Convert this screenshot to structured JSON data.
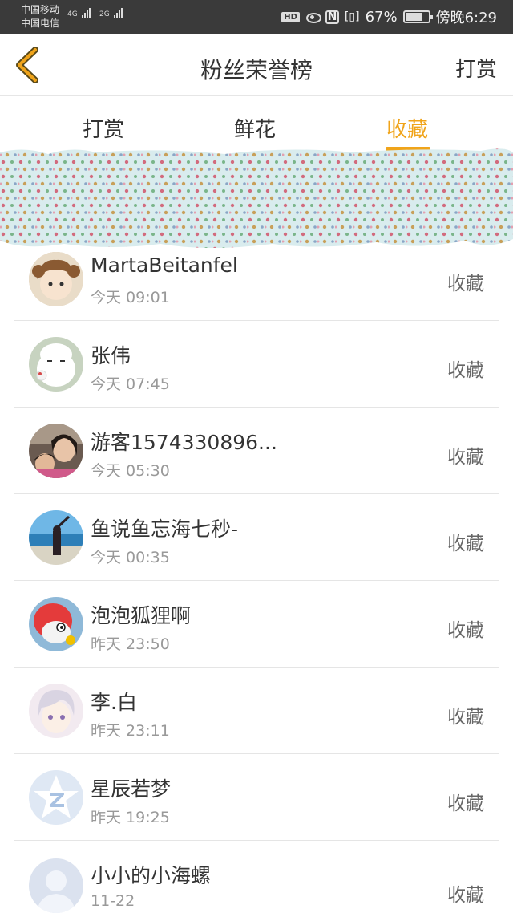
{
  "status_bar": {
    "carrier1": "中国移动",
    "carrier2": "中国电信",
    "net1": "4G",
    "net2": "2G",
    "hd": "HD",
    "nfc": "N",
    "battery": "67%",
    "time": "傍晚6:29"
  },
  "header": {
    "title": "粉丝荣誉榜",
    "right_action": "打赏"
  },
  "tabs": [
    {
      "label": "打赏",
      "active": false
    },
    {
      "label": "鲜花",
      "active": false
    },
    {
      "label": "收藏",
      "active": true
    }
  ],
  "colors": {
    "accent": "#f0a41a"
  },
  "fans": [
    {
      "name": "MartaBeitanfel",
      "time": "今天 09:01",
      "action": "收藏",
      "avatar": "anime-girl-avatar"
    },
    {
      "name": "张伟",
      "time": "今天 07:45",
      "action": "收藏",
      "avatar": "white-rabbit-avatar"
    },
    {
      "name": "游客1574330896...",
      "time": "今天 05:30",
      "action": "收藏",
      "avatar": "photo-people-avatar"
    },
    {
      "name": "鱼说鱼忘海七秒-",
      "time": "今天 00:35",
      "action": "收藏",
      "avatar": "beach-photo-avatar"
    },
    {
      "name": "泡泡狐狸啊",
      "time": "昨天 23:50",
      "action": "收藏",
      "avatar": "red-fox-avatar"
    },
    {
      "name": "李.白",
      "time": "昨天 23:11",
      "action": "收藏",
      "avatar": "anime-boy-avatar"
    },
    {
      "name": "星辰若梦",
      "time": "昨天 19:25",
      "action": "收藏",
      "avatar": "qq-star-avatar"
    },
    {
      "name": "小小的小海螺",
      "time": "11-22",
      "action": "收藏",
      "avatar": "default-user-avatar"
    }
  ]
}
